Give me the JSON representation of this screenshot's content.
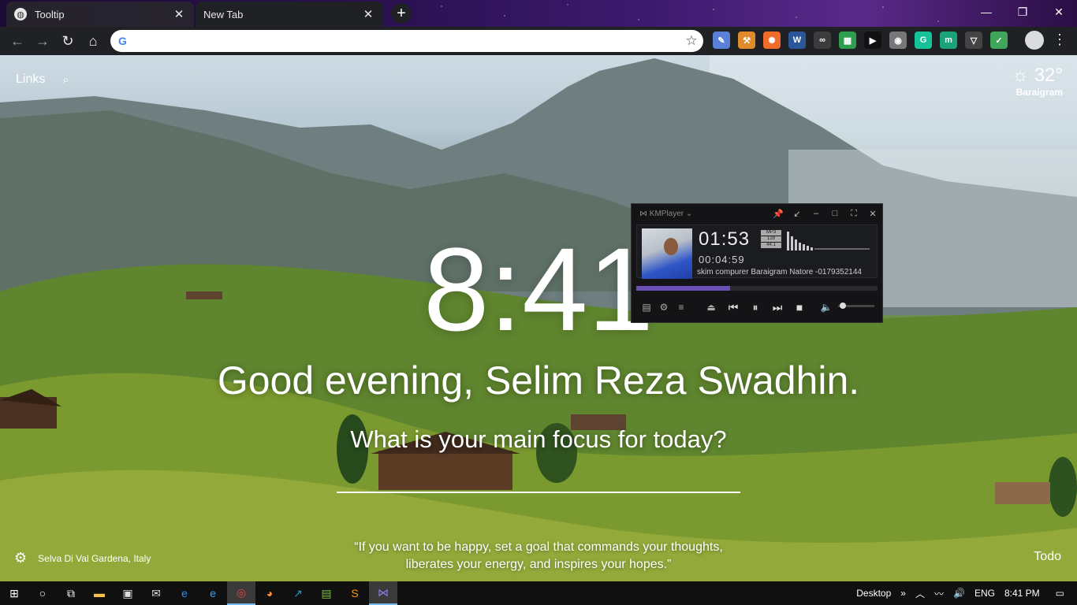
{
  "browser": {
    "tabs": [
      {
        "title": "Tooltip",
        "favicon": "globe-icon"
      },
      {
        "title": "New Tab",
        "favicon": "none"
      }
    ],
    "new_tab_symbol": "+",
    "window_controls": {
      "minimize": "—",
      "restore": "❐",
      "close": "✕"
    },
    "omnibox": {
      "value": "",
      "placeholder": ""
    },
    "extensions": [
      {
        "icon": "pen-icon",
        "color": "#5a7fd8"
      },
      {
        "icon": "hammer-icon",
        "color": "#e08a2c"
      },
      {
        "icon": "gear-orange-icon",
        "color": "#f06a2a"
      },
      {
        "icon": "word-icon",
        "color": "#2b579a"
      },
      {
        "icon": "glasses-icon",
        "color": "#3c3c3c"
      },
      {
        "icon": "grid-icon",
        "color": "#2e9e4f"
      },
      {
        "icon": "play-icon",
        "color": "#111111"
      },
      {
        "icon": "circle-icon",
        "color": "#777777"
      },
      {
        "icon": "grammarly-icon",
        "color": "#15c39a"
      },
      {
        "icon": "m-icon",
        "color": "#1aa37a"
      },
      {
        "icon": "shield-icon",
        "color": "#444444"
      },
      {
        "icon": "checklist-icon",
        "color": "#3fa55b"
      }
    ]
  },
  "momentum": {
    "links_label": "Links",
    "weather": {
      "temperature": "32°",
      "location": "Baraigram"
    },
    "clock": "8:41",
    "greeting": "Good evening, Selim Reza Swadhin.",
    "focus_question": "What is your main focus for today?",
    "photo_location": "Selva Di Val Gardena, Italy",
    "quote_line1": "“If you want to be happy, set a goal that commands your thoughts,",
    "quote_line2": "liberates your energy, and inspires your hopes.”",
    "todo_label": "Todo"
  },
  "kmplayer": {
    "brand": "KMPlayer",
    "current_time": "01:53",
    "total_time": "00:04:59",
    "format_badges": [
      "MP3",
      "128",
      "44.1"
    ],
    "track_title": "skim compurer Baraigram Natore -0179352144",
    "progress_fraction": 0.39,
    "volume_fraction": 0.05
  },
  "taskbar": {
    "desktop_label": "Desktop",
    "language": "ENG",
    "time": "8:41 PM",
    "apps": [
      {
        "icon": "windows-start-icon"
      },
      {
        "icon": "cortana-search-icon"
      },
      {
        "icon": "task-view-icon"
      },
      {
        "icon": "file-explorer-icon",
        "color": "#f2c14e"
      },
      {
        "icon": "store-icon",
        "color": "#dddddd"
      },
      {
        "icon": "mail-icon",
        "color": "#dddddd"
      },
      {
        "icon": "edge-icon",
        "color": "#2d8bf0"
      },
      {
        "icon": "internet-explorer-icon",
        "color": "#3aa0f0"
      },
      {
        "icon": "chrome-icon",
        "color": "#e8453c"
      },
      {
        "icon": "firefox-icon",
        "color": "#ff8a26"
      },
      {
        "icon": "app-blue-icon",
        "color": "#1c9ad6"
      },
      {
        "icon": "notepad-icon",
        "color": "#7fbf3f"
      },
      {
        "icon": "sublime-icon",
        "color": "#ff9800"
      },
      {
        "icon": "kmplayer-icon",
        "color": "#8c7fe6"
      }
    ]
  }
}
